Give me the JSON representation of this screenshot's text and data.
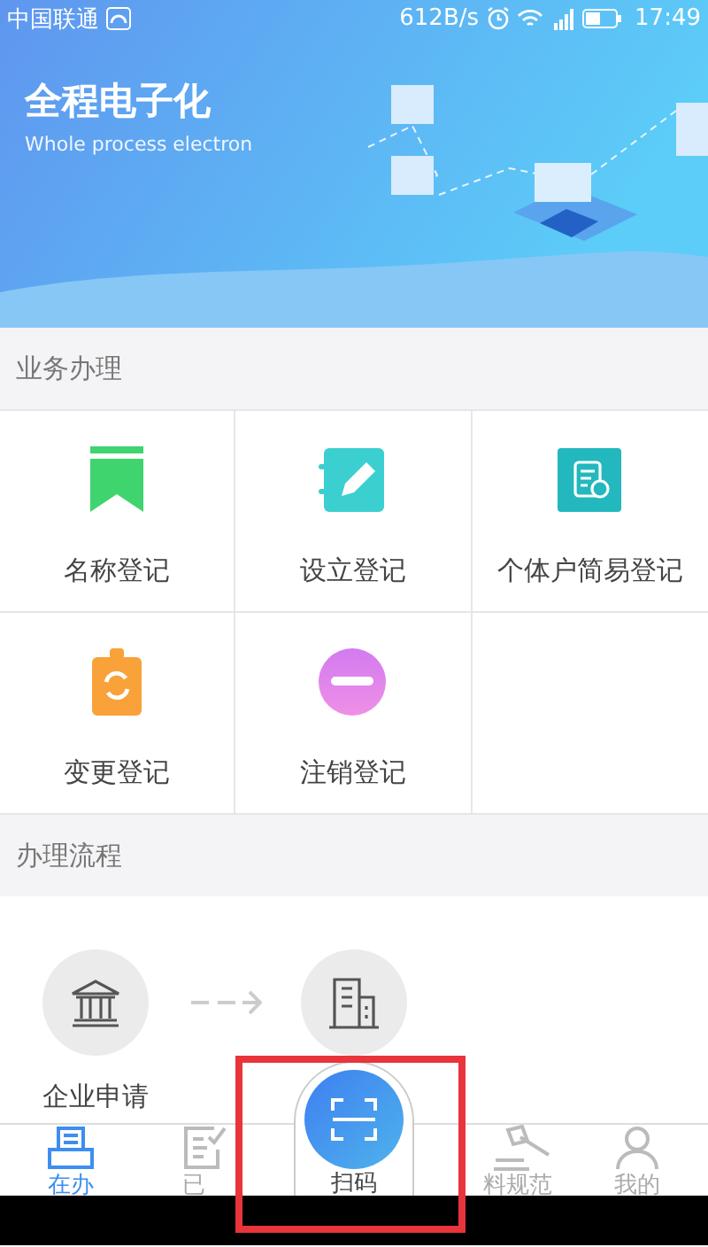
{
  "status_bar": {
    "carrier": "中国联通",
    "speed": "612B/s",
    "time": "17:49"
  },
  "banner": {
    "title": "全程电子化",
    "subtitle": "Whole process electron"
  },
  "services": {
    "title": "业务办理",
    "items": [
      {
        "label": "名称登记",
        "kind": "bookmark"
      },
      {
        "label": "设立登记",
        "kind": "notebook"
      },
      {
        "label": "个体户简易登记",
        "kind": "document"
      },
      {
        "label": "变更登记",
        "kind": "clipboard"
      },
      {
        "label": "注销登记",
        "kind": "minus"
      }
    ]
  },
  "process": {
    "title": "办理流程",
    "steps": [
      {
        "label": "企业申请",
        "kind": "bank"
      },
      {
        "kind": "building"
      }
    ]
  },
  "tab_bar": {
    "items": [
      {
        "label": "在办",
        "kind": "tray",
        "selected": true
      },
      {
        "label": "已",
        "kind": "checklist",
        "selected": false
      },
      {
        "label": "扫码",
        "kind": "scan",
        "selected": false
      },
      {
        "label": "料规范",
        "kind": "gavel",
        "selected": false
      },
      {
        "label": "我的",
        "kind": "person",
        "selected": false
      }
    ]
  }
}
